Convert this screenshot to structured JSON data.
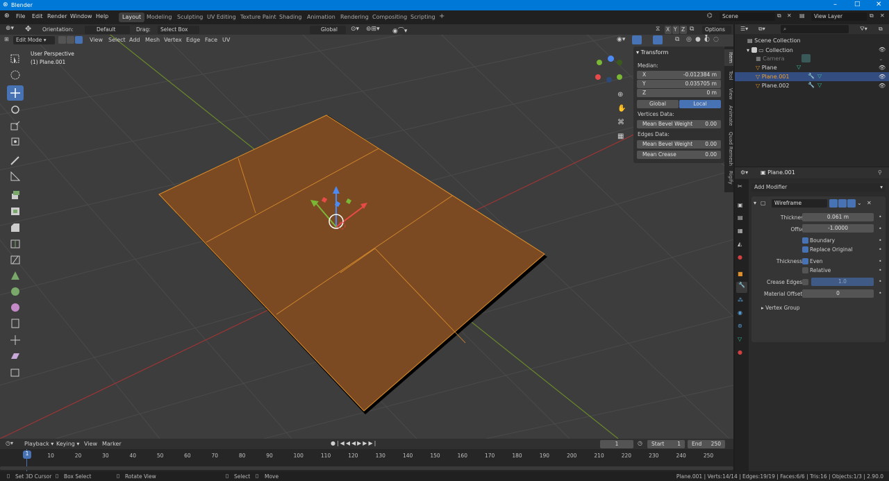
{
  "app": {
    "title": "Blender"
  },
  "menu": [
    "File",
    "Edit",
    "Render",
    "Window",
    "Help"
  ],
  "workspaces": [
    "Layout",
    "Modeling",
    "Sculpting",
    "UV Editing",
    "Texture Paint",
    "Shading",
    "Animation",
    "Rendering",
    "Compositing",
    "Scripting",
    "+"
  ],
  "scene": {
    "name": "Scene",
    "view_layer": "View Layer"
  },
  "header": {
    "orientation_label": "Orientation:",
    "orientation_value": "Default",
    "drag_label": "Drag:",
    "drag_value": "Select Box",
    "transform_orientation": "Global",
    "options": "Options",
    "axis_x": "X",
    "axis_y": "Y",
    "axis_z": "Z"
  },
  "header2": {
    "mode": "Edit Mode",
    "menus": [
      "View",
      "Select",
      "Add",
      "Mesh",
      "Vertex",
      "Edge",
      "Face",
      "UV"
    ]
  },
  "viewport": {
    "perspective": "User Perspective",
    "object": "(1) Plane.001"
  },
  "npanel": {
    "section": "Transform",
    "median": "Median:",
    "x_label": "X",
    "x_value": "-0.012384 m",
    "y_label": "Y",
    "y_value": "0.035705 m",
    "z_label": "Z",
    "z_value": "0 m",
    "global": "Global",
    "local": "Local",
    "vertices_data": "Vertices Data:",
    "edges_data": "Edges Data:",
    "mean_bevel_weight": "Mean Bevel Weight",
    "vbw_value": "0.00",
    "ebw_value": "0.00",
    "mean_crease": "Mean Crease",
    "crease_value": "0.00",
    "tabs": [
      "Item",
      "Tool",
      "View",
      "Animate",
      "Quad Remesh",
      "Rigify"
    ]
  },
  "outliner": {
    "scene_collection": "Scene Collection",
    "collection": "Collection",
    "items": [
      "Camera",
      "Plane",
      "Plane.001",
      "Plane.002"
    ]
  },
  "properties": {
    "object_name": "Plane.001",
    "add_modifier": "Add Modifier",
    "modifier_name": "Wireframe",
    "thickness_label": "Thickness",
    "thickness_value": "0.061 m",
    "offset_label": "Offset",
    "offset_value": "-1.0000",
    "boundary": "Boundary",
    "replace_original": "Replace Original",
    "thickness2_label": "Thickness",
    "even": "Even",
    "relative": "Relative",
    "crease_edges": "Crease Edges",
    "crease_value": "1.0",
    "material_offset": "Material Offset",
    "material_value": "0",
    "vertex_group": "Vertex Group"
  },
  "timeline": {
    "menus": [
      "Playback",
      "Keying",
      "View",
      "Marker"
    ],
    "current_frame": "1",
    "start_label": "Start",
    "start_value": "1",
    "end_label": "End",
    "end_value": "250",
    "ticks": [
      "1",
      "10",
      "20",
      "30",
      "40",
      "50",
      "60",
      "70",
      "80",
      "90",
      "100",
      "110",
      "120",
      "130",
      "140",
      "150",
      "160",
      "170",
      "180",
      "190",
      "200",
      "210",
      "220",
      "230",
      "240",
      "250"
    ]
  },
  "status": {
    "set_cursor": "Set 3D Cursor",
    "box_select": "Box Select",
    "rotate_view": "Rotate View",
    "select": "Select",
    "move": "Move",
    "stats": "Plane.001 | Verts:14/14 | Edges:19/19 | Faces:6/6 | Tris:16 | Objects:1/3 | 2.90.0"
  },
  "colors": {
    "accent": "#4772b3",
    "mesh": "#7b4a22",
    "edge": "#e0902a",
    "outline": "#f0a030"
  }
}
